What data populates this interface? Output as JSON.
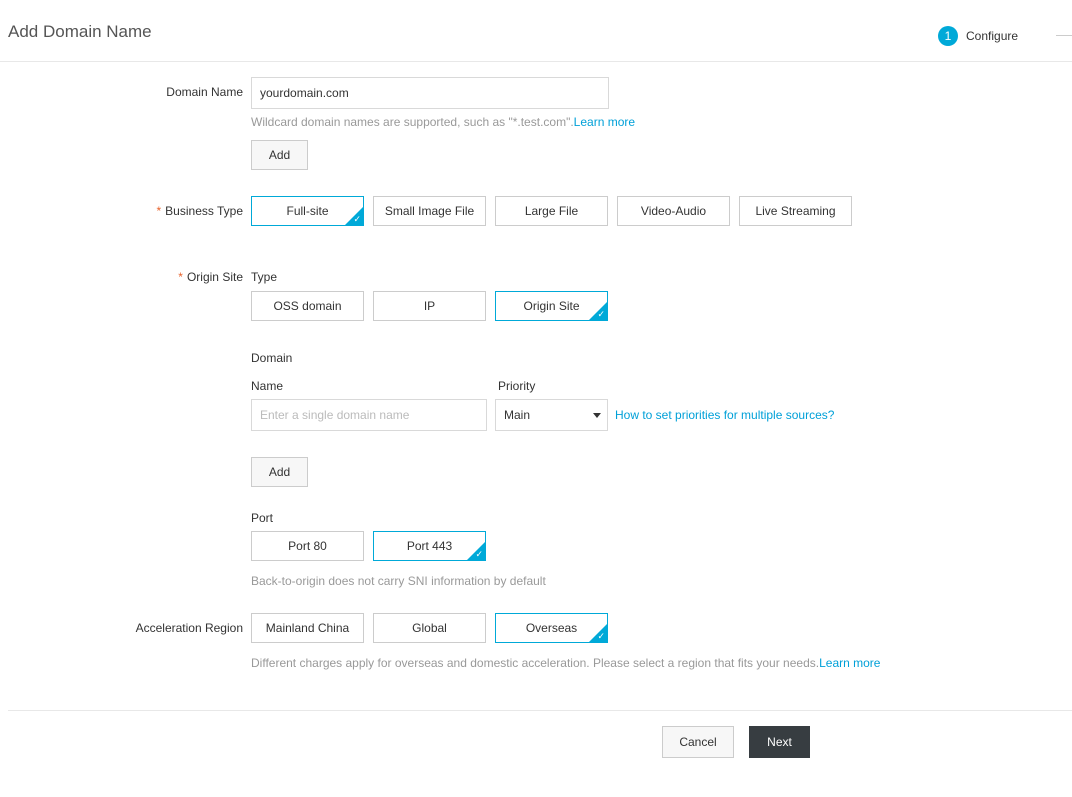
{
  "header": {
    "title": "Add Domain Name",
    "step_number": "1",
    "step_label": "Configure"
  },
  "domain_name": {
    "label": "Domain Name",
    "value": "yourdomain.com",
    "hint": "Wildcard domain names are supported, such as \"*.test.com\".",
    "hint_link": "Learn more",
    "add_label": "Add"
  },
  "business_type": {
    "required_mark": "*",
    "label": "Business Type",
    "options": [
      "Full-site",
      "Small Image File",
      "Large File",
      "Video-Audio",
      "Live Streaming"
    ],
    "selected": "Full-site"
  },
  "origin_site": {
    "required_mark": "*",
    "label": "Origin Site",
    "type_label": "Type",
    "types": [
      "OSS domain",
      "IP",
      "Origin Site"
    ],
    "selected_type": "Origin Site",
    "domain_section_label": "Domain",
    "name_label": "Name",
    "name_placeholder": "Enter a single domain name",
    "priority_label": "Priority",
    "priority_value": "Main",
    "priority_link": "How to set priorities for multiple sources?",
    "add_label": "Add",
    "port_label": "Port",
    "ports": [
      "Port 80",
      "Port 443"
    ],
    "selected_port": "Port 443",
    "port_hint": "Back-to-origin does not carry SNI information by default"
  },
  "acceleration_region": {
    "label": "Acceleration Region",
    "options": [
      "Mainland China",
      "Global",
      "Overseas"
    ],
    "selected": "Overseas",
    "hint": "Different charges apply for overseas and domestic acceleration. Please select a region that fits your needs.",
    "hint_link": "Learn more"
  },
  "footer": {
    "cancel_label": "Cancel",
    "next_label": "Next"
  },
  "colors": {
    "accent": "#00a9d8",
    "link": "#00a0d8",
    "required": "#e8622b",
    "primary_button": "#373d41"
  }
}
